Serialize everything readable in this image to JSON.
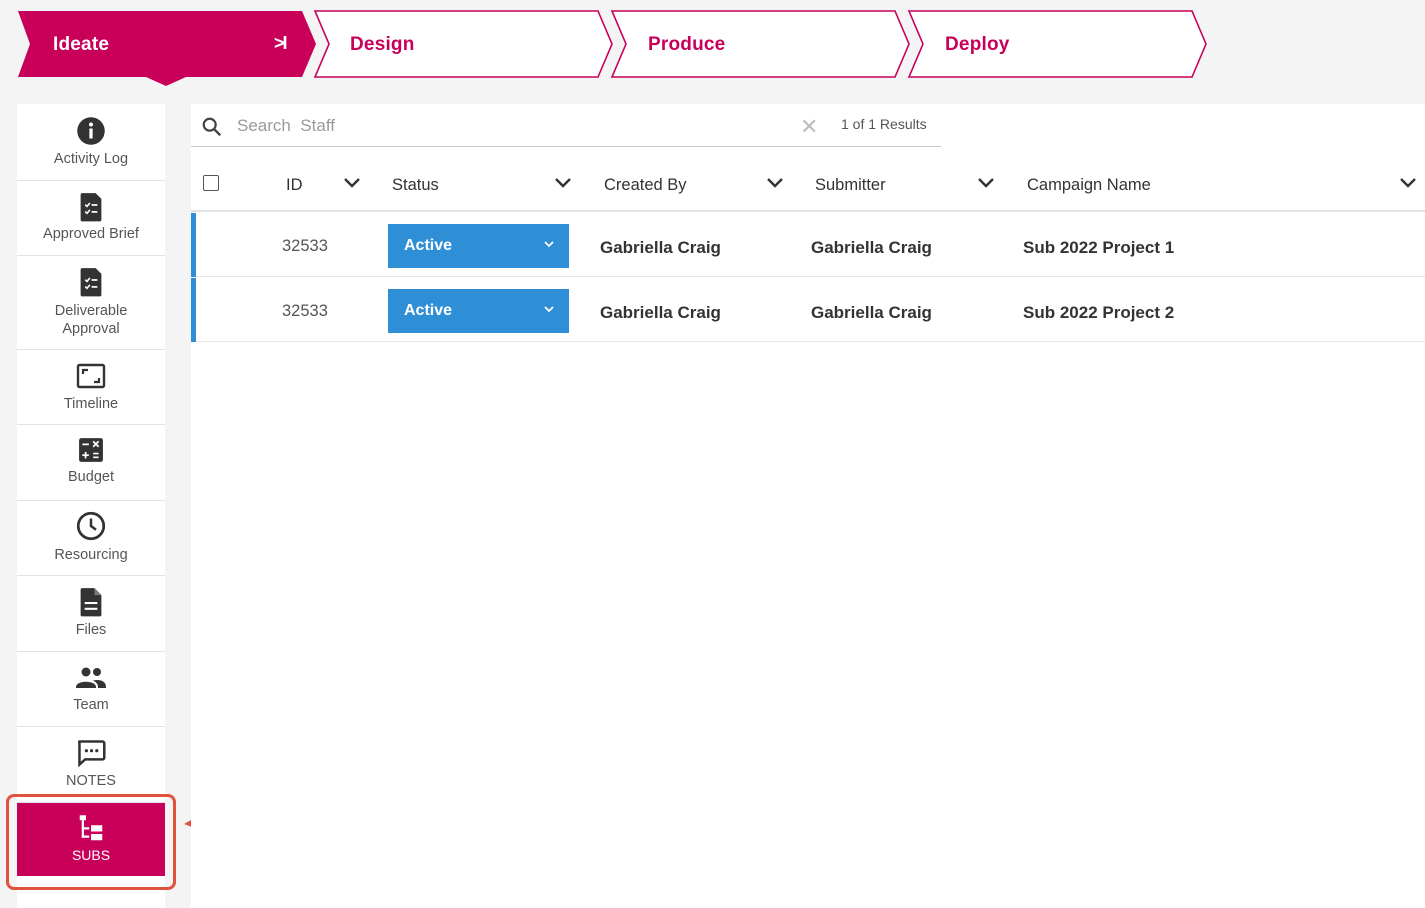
{
  "pipeline": {
    "steps": [
      {
        "label": "Ideate",
        "active": true
      },
      {
        "label": "Design",
        "active": false
      },
      {
        "label": "Produce",
        "active": false
      },
      {
        "label": "Deploy",
        "active": false
      }
    ],
    "collapse_glyph": ">I",
    "colors": {
      "brand": "#c8005a",
      "inactive_fill": "#ffffff"
    }
  },
  "sidebar": {
    "items": [
      {
        "label": "Activity Log",
        "icon": "info-icon"
      },
      {
        "label": "Approved Brief",
        "icon": "checklist-document-icon"
      },
      {
        "label": "Deliverable Approval",
        "icon": "checklist-document-icon"
      },
      {
        "label": "Timeline",
        "icon": "aspect-ratio-icon"
      },
      {
        "label": "Budget",
        "icon": "calculator-icon"
      },
      {
        "label": "Resourcing",
        "icon": "clock-icon"
      },
      {
        "label": "Files",
        "icon": "file-icon"
      },
      {
        "label": "Team",
        "icon": "people-icon"
      },
      {
        "label": "NOTES",
        "icon": "chat-icon"
      },
      {
        "label": "SUBS",
        "icon": "hierarchy-icon",
        "selected": true
      }
    ]
  },
  "search": {
    "placeholder": "Search  Staff",
    "value": "",
    "results_text": "1 of 1 Results"
  },
  "table": {
    "columns": [
      "ID",
      "Status",
      "Created By",
      "Submitter",
      "Campaign Name"
    ],
    "rows": [
      {
        "id": "32533",
        "status": "Active",
        "created_by": "Gabriella Craig",
        "submitter": "Gabriella Craig",
        "campaign": "Sub 2022 Project 1"
      },
      {
        "id": "32533",
        "status": "Active",
        "created_by": "Gabriella Craig",
        "submitter": "Gabriella Craig",
        "campaign": "Sub 2022 Project 2"
      }
    ],
    "colors": {
      "status_button": "#2f8fd6",
      "row_accent": "#2f8fd6"
    }
  },
  "annotation": {
    "color": "#e0533e"
  }
}
